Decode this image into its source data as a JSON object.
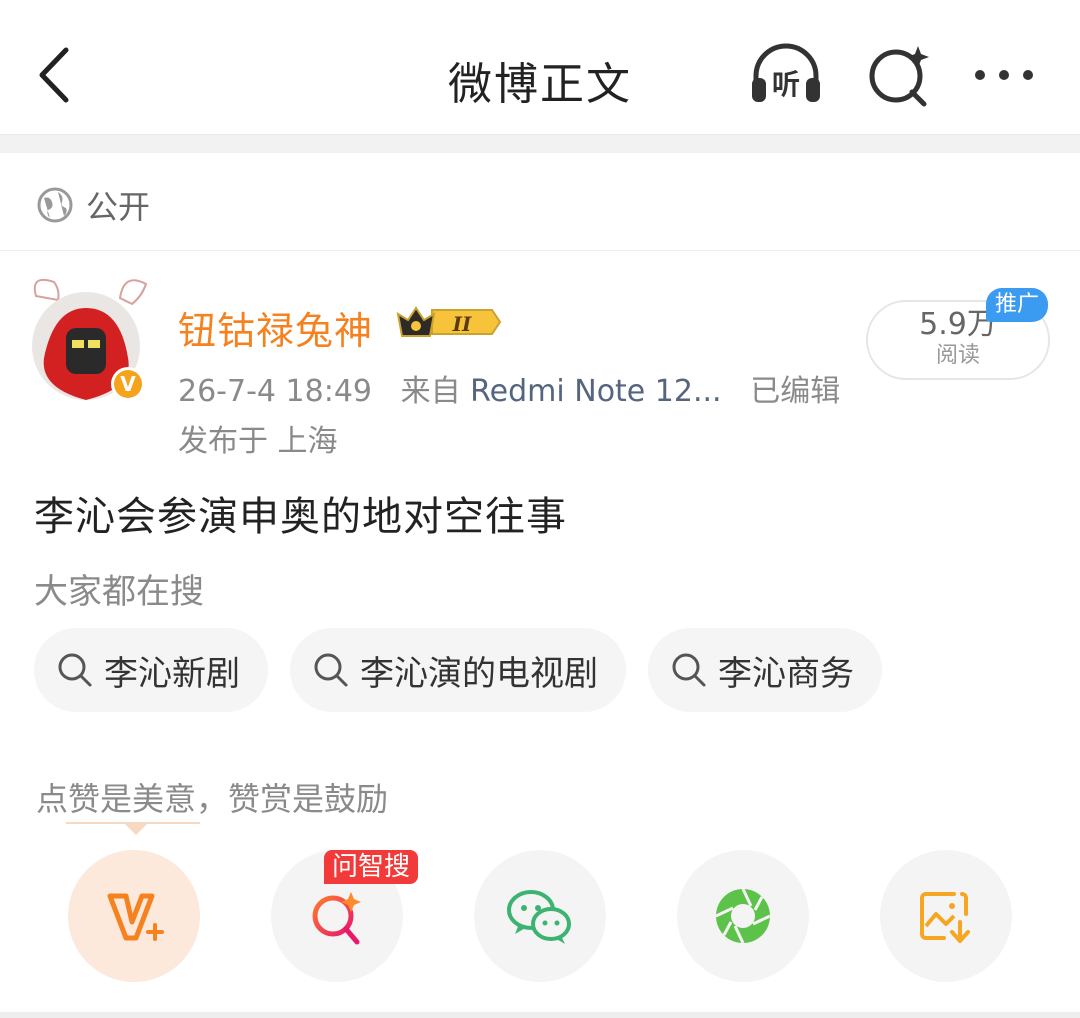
{
  "header": {
    "title": "微博正文",
    "listen_label": "听"
  },
  "visibility": {
    "label": "公开"
  },
  "post": {
    "author": "钮钴禄兔神",
    "vip_level": "II",
    "timestamp": "26-7-4 18:49",
    "source_prefix": "来自",
    "device": "Redmi Note 12...",
    "edited": "已编辑",
    "location": "发布于 上海",
    "text": "李沁会参演申奥的地对空往事",
    "reads_count": "5.9万",
    "reads_label": "阅读",
    "promo_badge": "推广"
  },
  "search_suggest": {
    "label": "大家都在搜",
    "chips": [
      "李沁新剧",
      "李沁演的电视剧",
      "李沁商务"
    ]
  },
  "appreciation": {
    "label": "点赞是美意，赞赏是鼓励",
    "ask_badge": "问智搜"
  },
  "colors": {
    "username": "#f5821f",
    "promo": "#3b9bf0",
    "ask_badge": "#f23a3a",
    "wechat": "#3cb371",
    "moments": "#5cc24a",
    "save_image": "#f5a623"
  }
}
